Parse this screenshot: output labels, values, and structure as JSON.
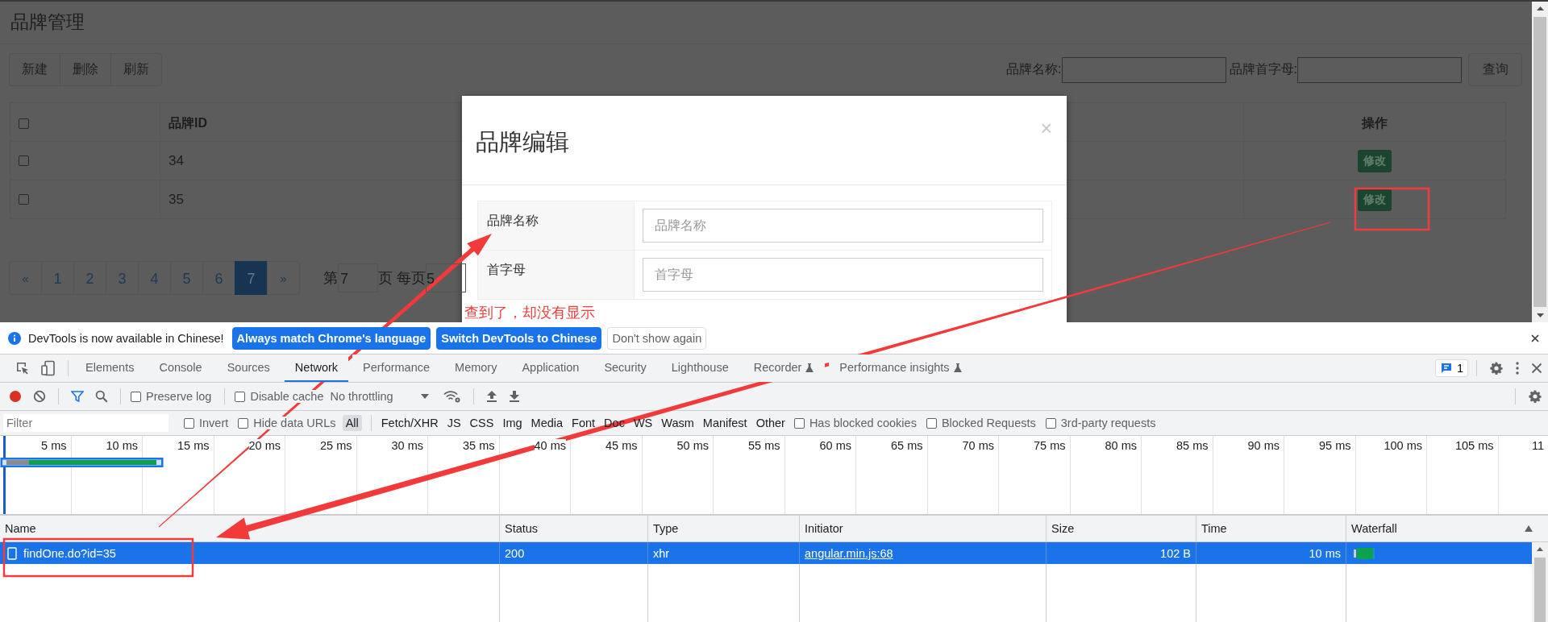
{
  "page": {
    "title": "品牌管理",
    "toolbar_buttons": [
      "新建",
      "删除",
      "刷新"
    ],
    "search_fields": [
      {
        "label": "品牌名称:"
      },
      {
        "label": "品牌首字母:"
      }
    ],
    "search_button": "查询",
    "table": {
      "select_all_checked": false,
      "columns": [
        "品牌ID",
        "操作"
      ],
      "rows": [
        {
          "checked": false,
          "id": "34",
          "action": "修改"
        },
        {
          "checked": false,
          "id": "35",
          "action": "修改"
        }
      ]
    },
    "pager": {
      "items": [
        {
          "label": "«",
          "selected": false
        },
        {
          "label": "1",
          "selected": false
        },
        {
          "label": "2",
          "selected": false
        },
        {
          "label": "3",
          "selected": false
        },
        {
          "label": "4",
          "selected": false
        },
        {
          "label": "5",
          "selected": false
        },
        {
          "label": "6",
          "selected": false
        },
        {
          "label": "7",
          "selected": true
        },
        {
          "label": "»",
          "selected": false
        }
      ],
      "prefix": "第",
      "page": "7",
      "middle": "页 每页",
      "size": "5"
    }
  },
  "modal": {
    "title": "品牌编辑",
    "close": "×",
    "fields": [
      {
        "label": "品牌名称",
        "placeholder": "品牌名称"
      },
      {
        "label": "首字母",
        "placeholder": "首字母"
      }
    ],
    "note": "查到了，却没有显示"
  },
  "devtools": {
    "infobar": {
      "message": "DevTools is now available in Chinese!",
      "buttons": [
        {
          "label": "Always match Chrome's language",
          "kind": "primary"
        },
        {
          "label": "Switch DevTools to Chinese",
          "kind": "primary"
        },
        {
          "label": "Don't show again",
          "kind": "secondary"
        }
      ]
    },
    "tabs": [
      {
        "label": "Elements",
        "selected": false,
        "experimental": false
      },
      {
        "label": "Console",
        "selected": false,
        "experimental": false
      },
      {
        "label": "Sources",
        "selected": false,
        "experimental": false
      },
      {
        "label": "Network",
        "selected": true,
        "experimental": false
      },
      {
        "label": "Performance",
        "selected": false,
        "experimental": false
      },
      {
        "label": "Memory",
        "selected": false,
        "experimental": false
      },
      {
        "label": "Application",
        "selected": false,
        "experimental": false
      },
      {
        "label": "Security",
        "selected": false,
        "experimental": false
      },
      {
        "label": "Lighthouse",
        "selected": false,
        "experimental": false
      },
      {
        "label": "Recorder",
        "selected": false,
        "experimental": true
      },
      {
        "label": "Performance insights",
        "selected": false,
        "experimental": true
      }
    ],
    "issues_count": "1",
    "toolbar": {
      "recording": true,
      "preserve_log": {
        "label": "Preserve log",
        "checked": false
      },
      "disable_cache": {
        "label": "Disable cache",
        "checked": false
      },
      "throttling": "No throttling"
    },
    "filter": {
      "placeholder": "Filter",
      "options": [
        {
          "label": "Invert",
          "checked": false
        },
        {
          "label": "Hide data URLs",
          "checked": false
        }
      ],
      "types": [
        {
          "label": "All",
          "selected": true
        },
        {
          "label": "Fetch/XHR",
          "selected": false
        },
        {
          "label": "JS",
          "selected": false
        },
        {
          "label": "CSS",
          "selected": false
        },
        {
          "label": "Img",
          "selected": false
        },
        {
          "label": "Media",
          "selected": false
        },
        {
          "label": "Font",
          "selected": false
        },
        {
          "label": "Doc",
          "selected": false
        },
        {
          "label": "WS",
          "selected": false
        },
        {
          "label": "Wasm",
          "selected": false
        },
        {
          "label": "Manifest",
          "selected": false
        },
        {
          "label": "Other",
          "selected": false
        }
      ],
      "flags": [
        {
          "label": "Has blocked cookies",
          "checked": false
        },
        {
          "label": "Blocked Requests",
          "checked": false
        },
        {
          "label": "3rd-party requests",
          "checked": false
        }
      ]
    },
    "overview": {
      "ticks": [
        "5 ms",
        "10 ms",
        "15 ms",
        "20 ms",
        "25 ms",
        "30 ms",
        "35 ms",
        "40 ms",
        "45 ms",
        "50 ms",
        "55 ms",
        "60 ms",
        "65 ms",
        "70 ms",
        "75 ms",
        "80 ms",
        "85 ms",
        "90 ms",
        "95 ms",
        "100 ms",
        "105 ms",
        "11"
      ]
    },
    "requests": {
      "columns": [
        "Name",
        "Status",
        "Type",
        "Initiator",
        "Size",
        "Time",
        "Waterfall"
      ],
      "rows": [
        {
          "name": "findOne.do?id=35",
          "status": "200",
          "type": "xhr",
          "initiator": "angular.min.js:68",
          "size": "102 B",
          "time": "10 ms",
          "selected": true
        }
      ]
    }
  }
}
